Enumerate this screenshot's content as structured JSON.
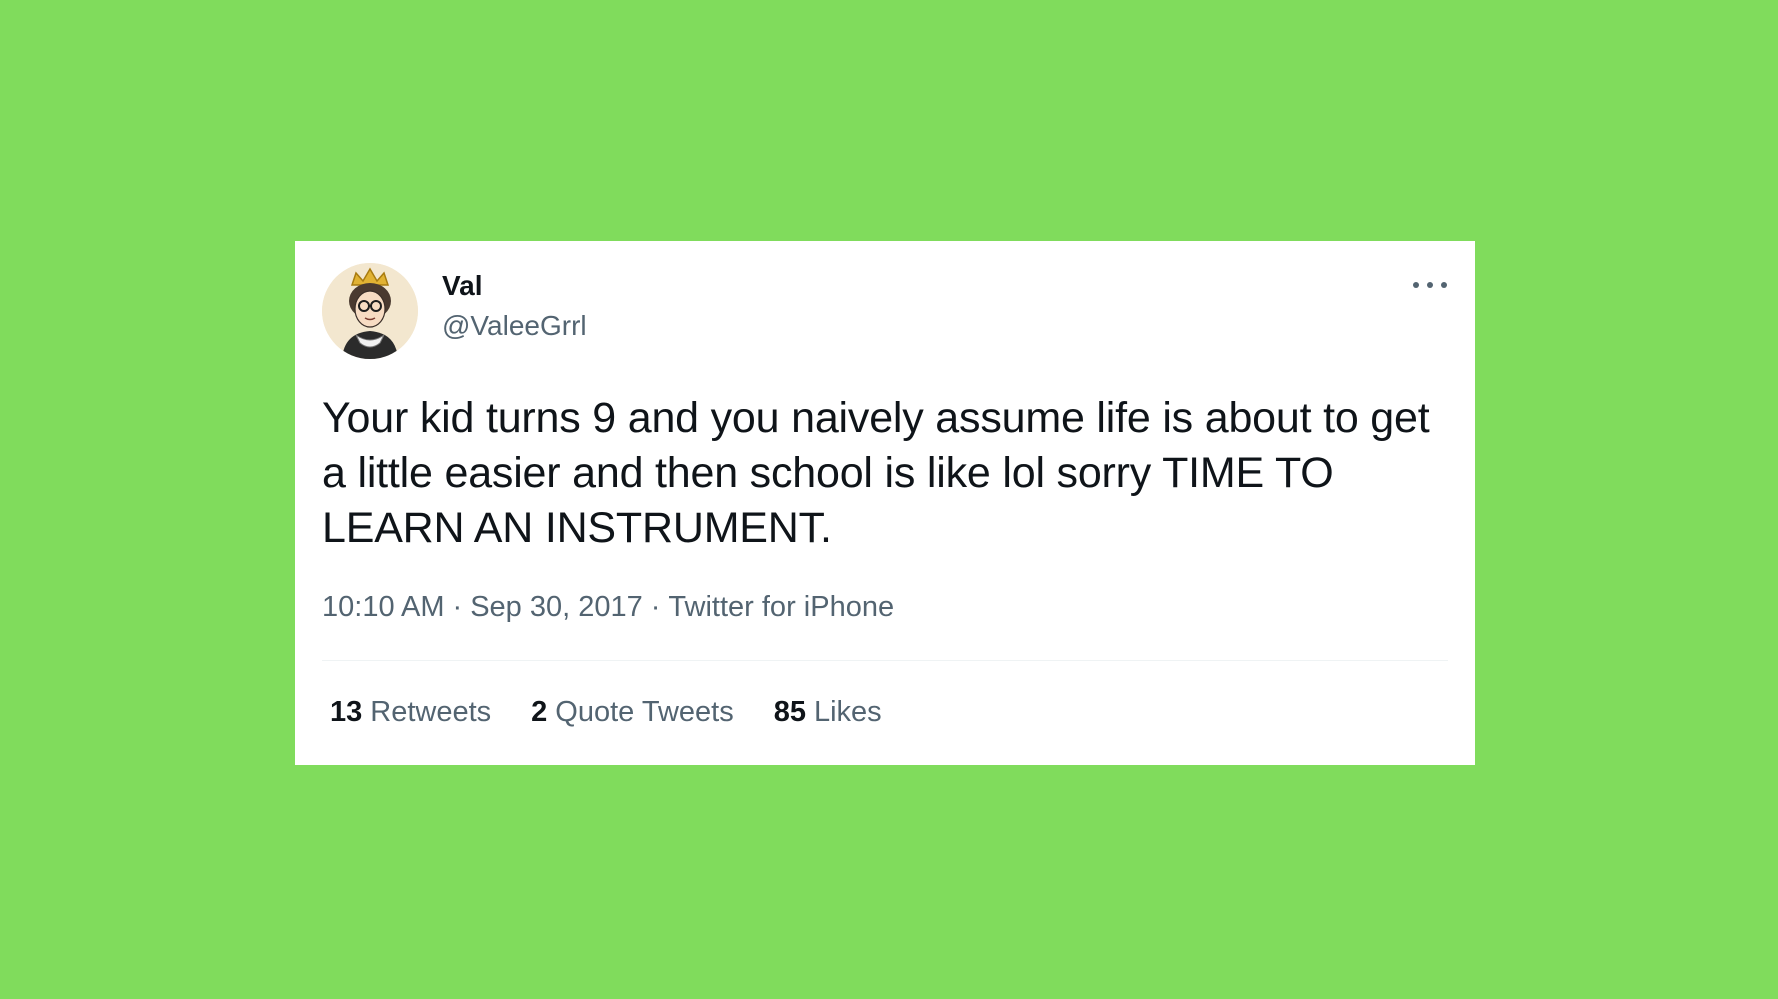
{
  "colors": {
    "background": "#80dc5c",
    "card": "#ffffff",
    "text_primary": "#0f1419",
    "text_secondary": "#536471"
  },
  "author": {
    "name": "Val",
    "handle": "@ValeeGrrl",
    "avatar_icon": "avatar-crowned-portrait"
  },
  "tweet": {
    "text": "Your kid turns 9 and you naively assume life is about to get a little easier and then school is like lol sorry TIME TO LEARN AN INSTRUMENT.",
    "time": "10:10 AM",
    "date": "Sep 30, 2017",
    "source": "Twitter for iPhone",
    "separator": "·"
  },
  "stats": {
    "retweets_count": "13",
    "retweets_label": "Retweets",
    "quotes_count": "2",
    "quotes_label": "Quote Tweets",
    "likes_count": "85",
    "likes_label": "Likes"
  },
  "menu": {
    "more_icon": "more-horizontal-icon"
  }
}
